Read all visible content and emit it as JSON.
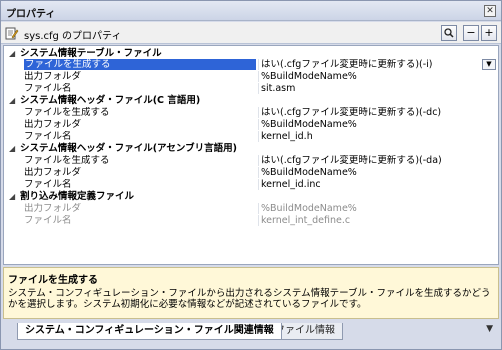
{
  "window": {
    "title": "プロパティ",
    "close_symbol": "✕"
  },
  "toolbar": {
    "label": "sys.cfg のプロパティ",
    "search_symbol": "🔍",
    "collapse_symbol": "−",
    "expand_symbol": "+"
  },
  "grid": {
    "categories": [
      {
        "name": "システム情報テーブル・ファイル",
        "props": [
          {
            "name": "ファイルを生成する",
            "value": "はい(.cfgファイル変更時に更新する)(-i)"
          },
          {
            "name": "出力フォルダ",
            "value": "%BuildModeName%"
          },
          {
            "name": "ファイル名",
            "value": "sit.asm"
          }
        ]
      },
      {
        "name": "システム情報ヘッダ・ファイル(C 言語用)",
        "props": [
          {
            "name": "ファイルを生成する",
            "value": "はい(.cfgファイル変更時に更新する)(-dc)"
          },
          {
            "name": "出力フォルダ",
            "value": "%BuildModeName%"
          },
          {
            "name": "ファイル名",
            "value": "kernel_id.h"
          }
        ]
      },
      {
        "name": "システム情報ヘッダ・ファイル(アセンブリ言語用)",
        "props": [
          {
            "name": "ファイルを生成する",
            "value": "はい(.cfgファイル変更時に更新する)(-da)"
          },
          {
            "name": "出力フォルダ",
            "value": "%BuildModeName%"
          },
          {
            "name": "ファイル名",
            "value": "kernel_id.inc"
          }
        ]
      },
      {
        "name": "割り込み情報定義ファイル",
        "props": [
          {
            "name": "出力フォルダ",
            "value": "%BuildModeName%"
          },
          {
            "name": "ファイル名",
            "value": "kernel_int_define.c"
          }
        ]
      }
    ]
  },
  "description": {
    "title": "ファイルを生成する",
    "text": "システム・コンフィギュレーション・ファイルから出力されるシステム情報テーブル・ファイルを生成するかどうかを選択します。システム初期化に必要な情報などが記述されているファイルです。"
  },
  "tabs": [
    {
      "label": "システム・コンフィギュレーション・ファイル関連情報"
    },
    {
      "label": "ファイル情報"
    }
  ],
  "colors": {
    "selection": "#2e64d7",
    "description_bg": "#fff8d8",
    "disabled_text": "#8c8c8c"
  },
  "icons": {
    "expand_arrow": "◢",
    "dropdown": "▼",
    "tab_menu": "▼"
  }
}
